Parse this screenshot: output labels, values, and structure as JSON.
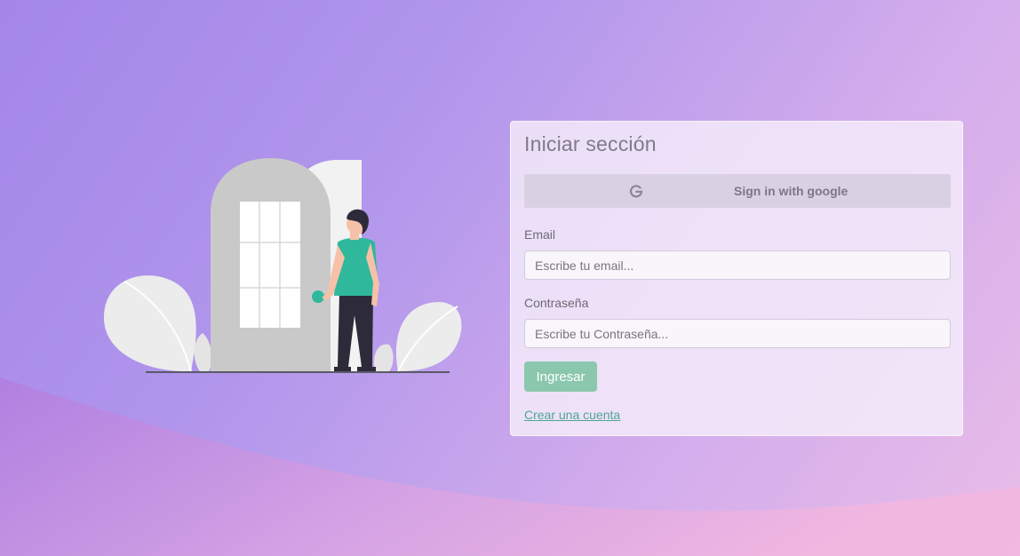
{
  "colors": {
    "background_start": "#a386e8",
    "background_end": "#e9bde8",
    "accent_green": "#8bc7ad",
    "link_green": "#4fa692",
    "card_background": "#f4ecfa"
  },
  "illustration": {
    "description_icon": "person-opening-door-illustration"
  },
  "login": {
    "title": "Iniciar sección",
    "google_button": {
      "icon": "google-icon",
      "label": "Sign in with google"
    },
    "email": {
      "label": "Email",
      "placeholder": "Escribe tu email..."
    },
    "password": {
      "label": "Contraseña",
      "placeholder": "Escribe tu Contraseña..."
    },
    "submit_label": "Ingresar",
    "create_account_link": "Crear una cuenta"
  }
}
